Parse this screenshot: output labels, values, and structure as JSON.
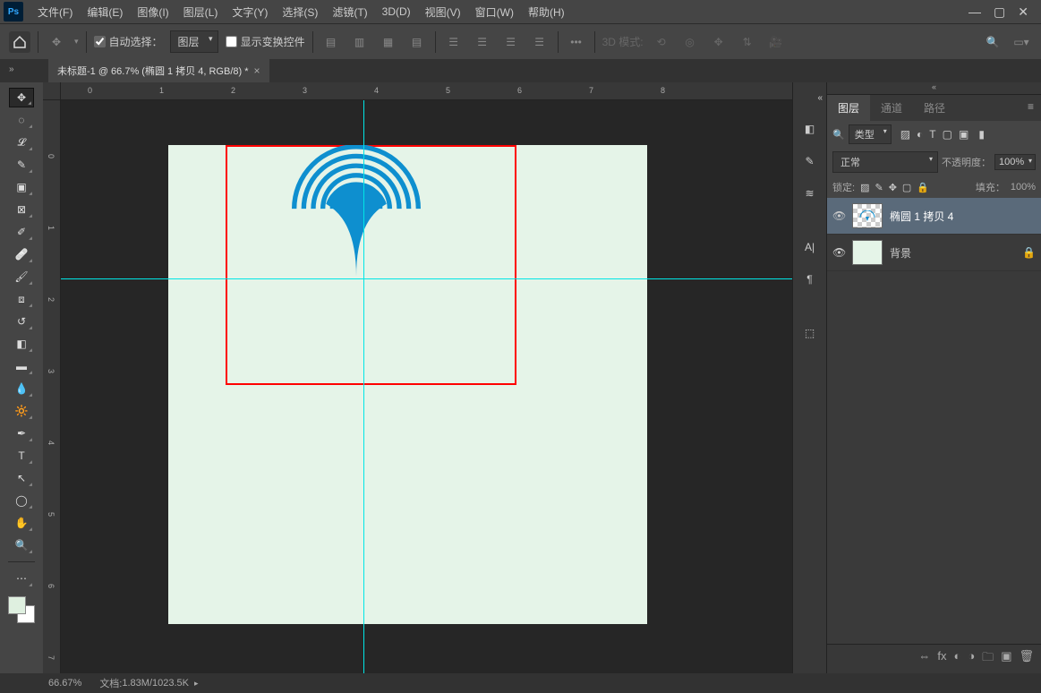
{
  "app": {
    "logo": "Ps"
  },
  "menu": {
    "items": [
      "文件(F)",
      "编辑(E)",
      "图像(I)",
      "图层(L)",
      "文字(Y)",
      "选择(S)",
      "滤镜(T)",
      "3D(D)",
      "视图(V)",
      "窗口(W)",
      "帮助(H)"
    ]
  },
  "options": {
    "auto_select_label": "自动选择：",
    "auto_select_target": "图层",
    "show_transform": "显示变换控件",
    "mode3d_label": "3D 模式:"
  },
  "tab": {
    "title": "未标题-1 @ 66.7% (椭圆 1 拷贝 4, RGB/8) *"
  },
  "ruler": {
    "h": [
      "0",
      "1",
      "2",
      "3",
      "4",
      "5",
      "6",
      "7",
      "8"
    ],
    "v": [
      "0",
      "1",
      "2",
      "3",
      "4",
      "5",
      "6",
      "7"
    ]
  },
  "panels": {
    "layers": {
      "tabs": {
        "layers": "图层",
        "channels": "通道",
        "paths": "路径"
      },
      "kind_label": "类型",
      "blend_mode": "正常",
      "opacity_label": "不透明度：",
      "opacity_value": "100%",
      "lock_label": "锁定:",
      "fill_label": "填充：",
      "fill_value": "100%",
      "layer_list": [
        {
          "name": "椭圆 1 拷贝 4",
          "visible": true,
          "selected": true,
          "thumb": "checker"
        },
        {
          "name": "背景",
          "visible": true,
          "selected": false,
          "thumb": "solid",
          "locked": true
        }
      ]
    }
  },
  "status": {
    "zoom": "66.67%",
    "doc_label": "文档:",
    "doc_info": "1.83M/1023.5K"
  },
  "colors": {
    "canvas": "#e5f4e8",
    "accent": "#0e8fcf",
    "guide": "#00e6e6",
    "annotation": "#ff0000"
  }
}
